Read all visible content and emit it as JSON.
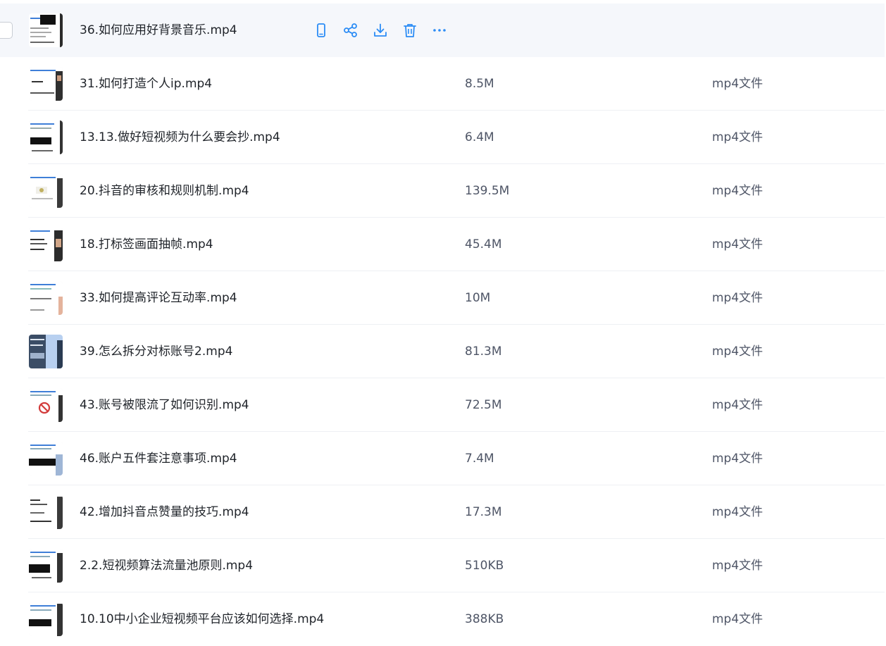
{
  "colors": {
    "accent": "#2b8cf5",
    "hover_row_bg": "#f5f7fb",
    "text_primary": "#1f2329",
    "text_secondary": "#4e5566",
    "divider": "#eef0f4"
  },
  "hovered_row": {
    "name": "36.如何应用好背景音乐.mp4",
    "actions": [
      {
        "icon": "phone-icon",
        "label": "phone"
      },
      {
        "icon": "share-icon",
        "label": "share"
      },
      {
        "icon": "download-icon",
        "label": "download"
      },
      {
        "icon": "trash-icon",
        "label": "delete"
      },
      {
        "icon": "more-icon",
        "label": "more"
      }
    ]
  },
  "files": [
    {
      "name": "31.如何打造个人ip.mp4",
      "size": "8.5M",
      "type": "mp4文件"
    },
    {
      "name": "13.13.做好短视频为什么要会抄.mp4",
      "size": "6.4M",
      "type": "mp4文件"
    },
    {
      "name": "20.抖音的审核和规则机制.mp4",
      "size": "139.5M",
      "type": "mp4文件"
    },
    {
      "name": "18.打标签画面抽帧.mp4",
      "size": "45.4M",
      "type": "mp4文件"
    },
    {
      "name": "33.如何提高评论互动率.mp4",
      "size": "10M",
      "type": "mp4文件"
    },
    {
      "name": "39.怎么拆分对标账号2.mp4",
      "size": "81.3M",
      "type": "mp4文件"
    },
    {
      "name": "43.账号被限流了如何识别.mp4",
      "size": "72.5M",
      "type": "mp4文件"
    },
    {
      "name": "46.账户五件套注意事项.mp4",
      "size": "7.4M",
      "type": "mp4文件"
    },
    {
      "name": "42.增加抖音点赞量的技巧.mp4",
      "size": "17.3M",
      "type": "mp4文件"
    },
    {
      "name": "2.2.短视频算法流量池原则.mp4",
      "size": "510KB",
      "type": "mp4文件"
    },
    {
      "name": "10.10中小企业短视频平台应该如何选择.mp4",
      "size": "388KB",
      "type": "mp4文件"
    }
  ]
}
